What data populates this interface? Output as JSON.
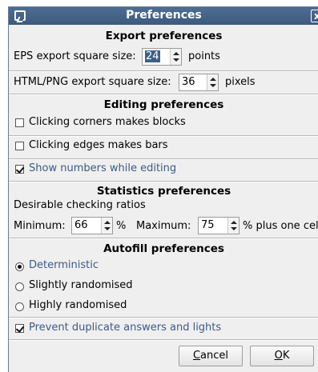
{
  "window": {
    "title": "Preferences",
    "close_symbol": "x"
  },
  "export": {
    "heading": "Export preferences",
    "eps_label": "EPS export square size:",
    "eps_value": "24",
    "eps_unit": "points",
    "html_label": "HTML/PNG export square size:",
    "html_value": "36",
    "html_unit": "pixels"
  },
  "editing": {
    "heading": "Editing preferences",
    "options": [
      {
        "label": "Clicking corners makes blocks",
        "checked": false
      },
      {
        "label": "Clicking edges makes bars",
        "checked": false
      },
      {
        "label": "Show numbers while editing",
        "checked": true
      }
    ]
  },
  "statistics": {
    "heading": "Statistics preferences",
    "subtitle": "Desirable checking ratios",
    "min_label": "Minimum:",
    "min_value": "66",
    "min_unit": "%",
    "max_label": "Maximum:",
    "max_value": "75",
    "max_unit": "% plus one cel"
  },
  "autofill": {
    "heading": "Autofill preferences",
    "modes": [
      {
        "label": "Deterministic",
        "selected": true
      },
      {
        "label": "Slightly randomised",
        "selected": false
      },
      {
        "label": "Highly randomised",
        "selected": false
      }
    ],
    "prevent_label": "Prevent duplicate answers and lights",
    "prevent_checked": true
  },
  "buttons": {
    "cancel_mnemonic": "C",
    "cancel_rest": "ancel",
    "ok_mnemonic": "O",
    "ok_rest": "K"
  },
  "colors": {
    "title_bar": "#44638a",
    "accent_text": "#3d5a87",
    "selection": "#3e5f87"
  }
}
